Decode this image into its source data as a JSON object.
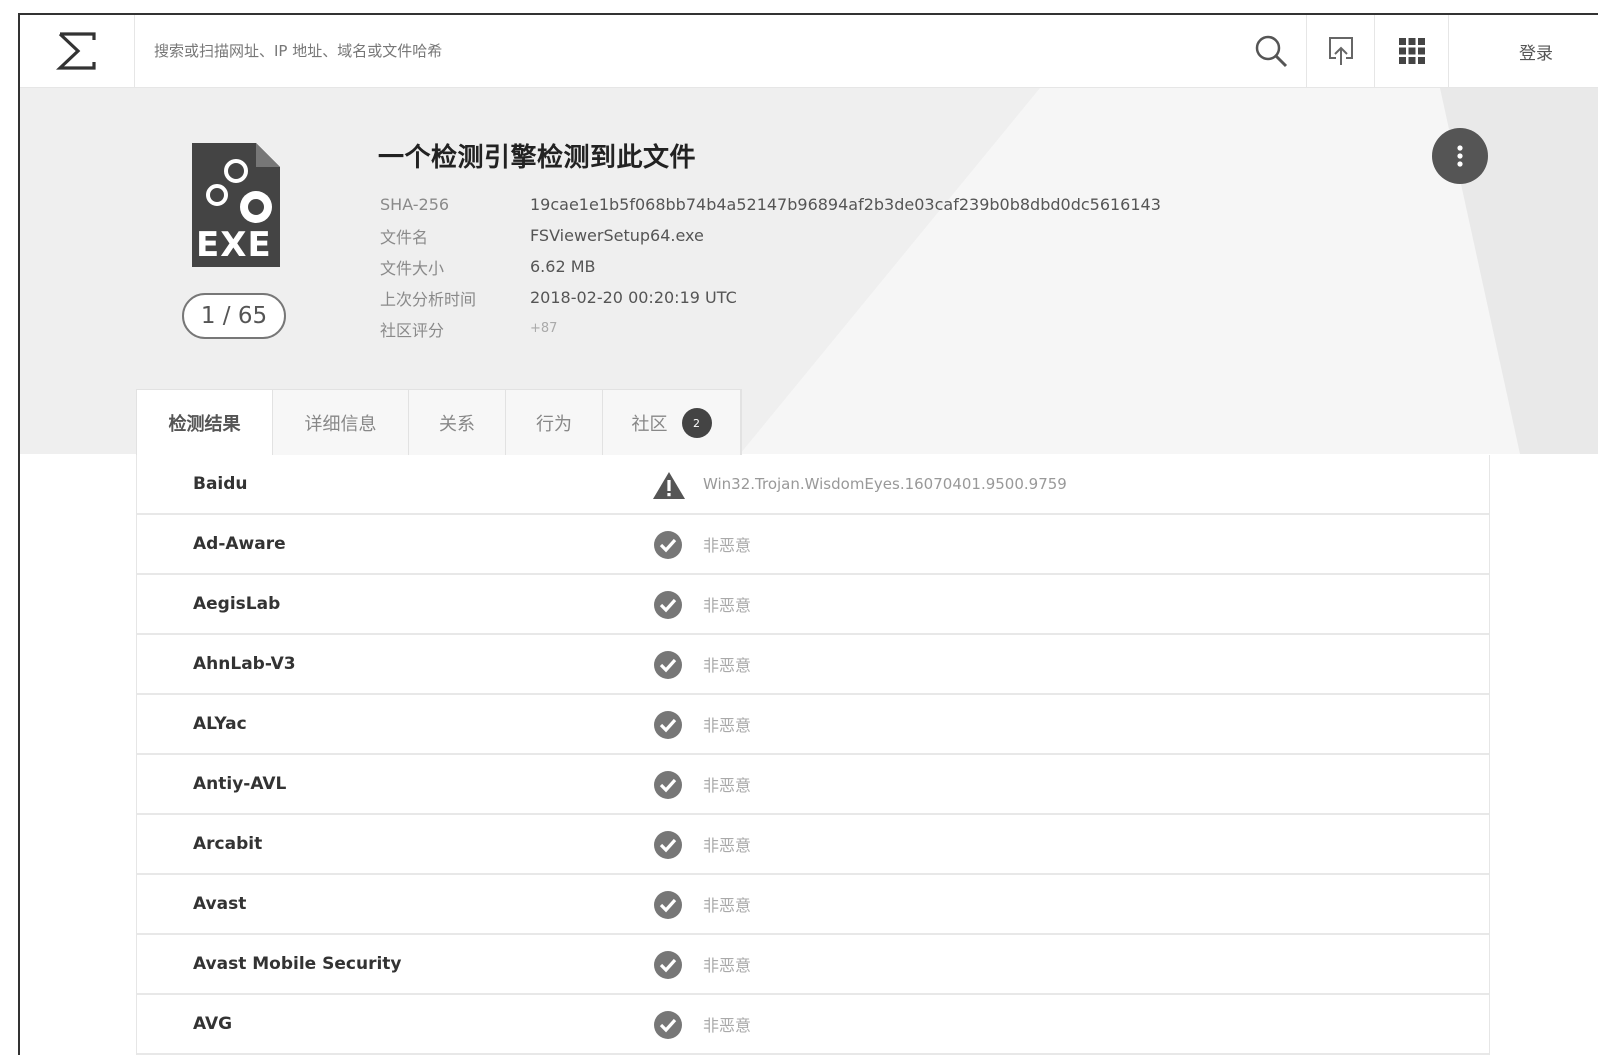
{
  "header": {
    "search_placeholder": "搜索或扫描网址、IP 地址、域名或文件哈希",
    "login_label": "登录"
  },
  "summary": {
    "ratio": "1 / 65",
    "file_type_badge": "EXE",
    "title": "一个检测引擎检测到此文件",
    "meta": [
      {
        "label": "SHA-256",
        "value": "19cae1e1b5f068bb74b4a52147b96894af2b3de03caf239b0b8dbd0dc5616143"
      },
      {
        "label": "文件名",
        "value": "FSViewerSetup64.exe"
      },
      {
        "label": "文件大小",
        "value": "6.62 MB"
      },
      {
        "label": "上次分析时间",
        "value": "2018-02-20 00:20:19 UTC"
      },
      {
        "label": "社区评分",
        "value": "+87"
      }
    ]
  },
  "tabs": [
    {
      "label": "检测结果",
      "active": true
    },
    {
      "label": "详细信息"
    },
    {
      "label": "关系"
    },
    {
      "label": "行为"
    },
    {
      "label": "社区",
      "badge": "2"
    }
  ],
  "results": [
    {
      "engine": "Baidu",
      "status": "threat",
      "verdict": "Win32.Trojan.WisdomEyes.16070401.9500.9759"
    },
    {
      "engine": "Ad-Aware",
      "status": "clean",
      "verdict": "非恶意"
    },
    {
      "engine": "AegisLab",
      "status": "clean",
      "verdict": "非恶意"
    },
    {
      "engine": "AhnLab-V3",
      "status": "clean",
      "verdict": "非恶意"
    },
    {
      "engine": "ALYac",
      "status": "clean",
      "verdict": "非恶意"
    },
    {
      "engine": "Antiy-AVL",
      "status": "clean",
      "verdict": "非恶意"
    },
    {
      "engine": "Arcabit",
      "status": "clean",
      "verdict": "非恶意"
    },
    {
      "engine": "Avast",
      "status": "clean",
      "verdict": "非恶意"
    },
    {
      "engine": "Avast Mobile Security",
      "status": "clean",
      "verdict": "非恶意"
    },
    {
      "engine": "AVG",
      "status": "clean",
      "verdict": "非恶意"
    }
  ],
  "icons": {
    "logo": "sigma-logo-icon",
    "search": "search-icon",
    "upload": "upload-icon",
    "apps": "apps-grid-icon",
    "more": "more-vertical-icon",
    "file": "exe-file-icon",
    "threat": "warning-triangle-icon",
    "clean": "check-circle-icon"
  },
  "colors": {
    "accent": "#444444",
    "background_band": "#efefef"
  }
}
